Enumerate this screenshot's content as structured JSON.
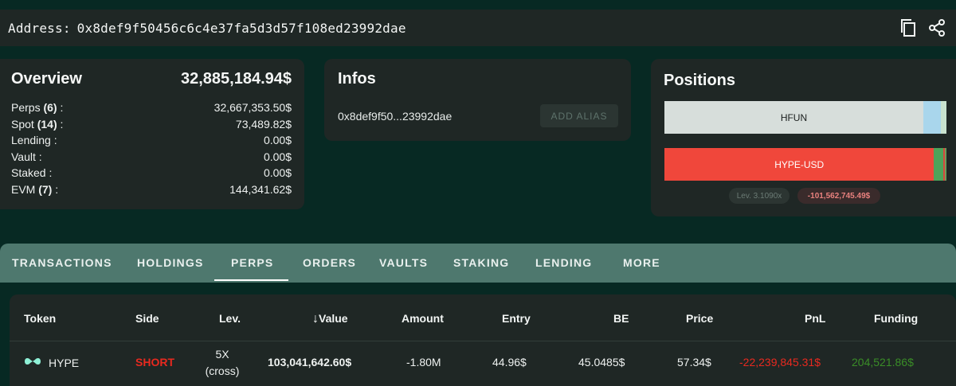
{
  "address_bar": {
    "label": "Address:",
    "value": "0x8def9f50456c6c4e37fa5d3d57f108ed23992dae",
    "icons": [
      "copy-icon",
      "share-icon"
    ]
  },
  "overview": {
    "title": "Overview",
    "total": "32,885,184.94$",
    "rows": [
      {
        "label": "Perps",
        "count": "(6)",
        "suffix": " :",
        "value": "32,667,353.50$"
      },
      {
        "label": "Spot",
        "count": "(14)",
        "suffix": " :",
        "value": "73,489.82$"
      },
      {
        "label": "Lending :",
        "count": "",
        "suffix": "",
        "value": "0.00$"
      },
      {
        "label": "Vault :",
        "count": "",
        "suffix": "",
        "value": "0.00$"
      },
      {
        "label": "Staked :",
        "count": "",
        "suffix": "",
        "value": "0.00$"
      },
      {
        "label": "EVM",
        "count": "(7)",
        "suffix": " :",
        "value": "144,341.62$"
      }
    ]
  },
  "infos": {
    "title": "Infos",
    "short_address": "0x8def9f50...23992dae",
    "alias_button": "ADD ALIAS"
  },
  "positions": {
    "title": "Positions",
    "bars": [
      {
        "label": "HFUN",
        "main_fraction": 0.918,
        "main_color": "#d7dedb",
        "text_color": "#1b1f1e",
        "extra_colors": [
          "#a9d6ec",
          "#c9e3cf"
        ]
      },
      {
        "label": "HYPE-USD",
        "main_fraction": 0.956,
        "main_color": "#f0473b",
        "text_color": "#ffffff",
        "extra_colors": [
          "#4ea35a",
          "#d8483e",
          "#6d9a5a"
        ]
      }
    ],
    "leverage_pill": "Lev. 3.1090x",
    "pnl_pill": "-101,562,745.49$"
  },
  "tabs": {
    "items": [
      "TRANSACTIONS",
      "HOLDINGS",
      "PERPS",
      "ORDERS",
      "VAULTS",
      "STAKING",
      "LENDING",
      "MORE"
    ],
    "active": "PERPS"
  },
  "table": {
    "sort_arrow": "↓",
    "columns": [
      "Token",
      "Side",
      "Lev.",
      "Value",
      "Amount",
      "Entry",
      "BE",
      "Price",
      "PnL",
      "Funding"
    ],
    "rows": [
      {
        "token": "HYPE",
        "token_icon": "hyperliquid-logo-icon",
        "side": "SHORT",
        "lev_line1": "5X",
        "lev_line2": "(cross)",
        "value": "103,041,642.60$",
        "amount": "-1.80M",
        "entry": "44.96$",
        "be": "45.0485$",
        "price": "57.34$",
        "pnl": "-22,239,845.31$",
        "funding": "204,521.86$"
      }
    ],
    "colors": {
      "short": "#e8291f",
      "pnl_negative": "#e8291f",
      "funding_positive": "#3a8d27"
    }
  }
}
